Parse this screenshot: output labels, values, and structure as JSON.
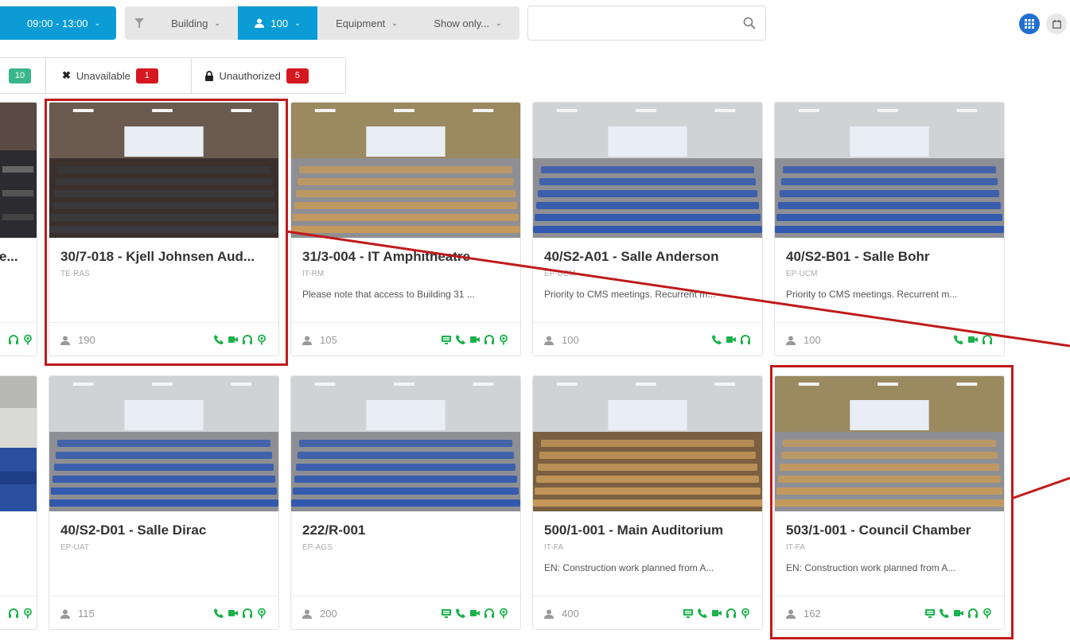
{
  "toolbar": {
    "time_range": "09:00 - 13:00",
    "building": "Building",
    "capacity": "100",
    "equipment": "Equipment",
    "show_only": "Show only..."
  },
  "search": {
    "value": "",
    "placeholder": ""
  },
  "status": {
    "available_count": "10",
    "unavailable_label": "Unavailable",
    "unavailable_count": "1",
    "unauthorized_label": "Unauthorized",
    "unauthorized_count": "5"
  },
  "colors": {
    "accent": "#0b9cd6",
    "equipment_icon": "#1bb24b",
    "badge_red": "#d51820",
    "badge_green": "#3ab68b",
    "highlight": "#c01a1a"
  },
  "icons": [
    "filter-icon",
    "user-icon",
    "search-icon",
    "grid-view-icon",
    "calendar-icon",
    "x-icon",
    "lock-icon",
    "monitor-icon",
    "phone-icon",
    "video-camera-icon",
    "headphones-icon",
    "microphone-icon"
  ],
  "edge_row1": {
    "title": "e...",
    "capacity": ""
  },
  "rooms": [
    {
      "title": "30/7-018 - Kjell Johnsen Aud...",
      "dept": "TE-RAS",
      "note": "",
      "capacity": "190"
    },
    {
      "title": "31/3-004 - IT Amphitheatre",
      "dept": "IT-RM",
      "note": "Please note that access to Building 31 ...",
      "capacity": "105"
    },
    {
      "title": "40/S2-A01 - Salle Anderson",
      "dept": "EP-UCM",
      "note": "Priority to CMS meetings. Recurrent m...",
      "capacity": "100"
    },
    {
      "title": "40/S2-B01 - Salle Bohr",
      "dept": "EP-UCM",
      "note": "Priority to CMS meetings. Recurrent m...",
      "capacity": "100"
    },
    {
      "title": "40/S2-D01 - Salle Dirac",
      "dept": "EP-UAT",
      "note": "",
      "capacity": "115"
    },
    {
      "title": "222/R-001",
      "dept": "EP-AGS",
      "note": "",
      "capacity": "200"
    },
    {
      "title": "500/1-001 - Main Auditorium",
      "dept": "IT-FA",
      "note": "EN: Construction work planned from A...",
      "capacity": "400"
    },
    {
      "title": "503/1-001 - Council Chamber",
      "dept": "IT-FA",
      "note": "EN: Construction work planned from A...",
      "capacity": "162"
    }
  ]
}
